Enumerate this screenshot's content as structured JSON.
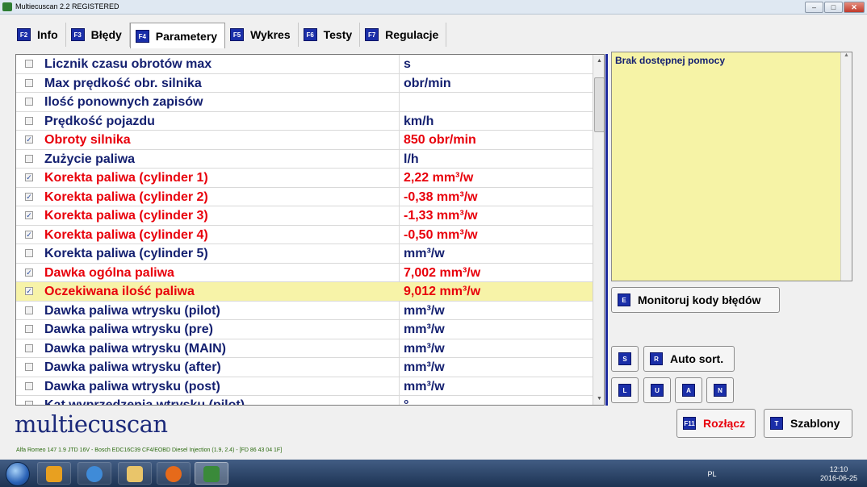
{
  "window": {
    "title": "Multiecuscan 2.2 REGISTERED"
  },
  "tabs": [
    {
      "key": "F2",
      "label": "Info"
    },
    {
      "key": "F3",
      "label": "Błędy"
    },
    {
      "key": "F4",
      "label": "Parametery",
      "active": true
    },
    {
      "key": "F5",
      "label": "Wykres"
    },
    {
      "key": "F6",
      "label": "Testy"
    },
    {
      "key": "F7",
      "label": "Regulacje"
    }
  ],
  "parameters": [
    {
      "name": "Licznik czasu obrotów max",
      "value": "s",
      "checked": false
    },
    {
      "name": "Max prędkość obr. silnika",
      "value": "obr/min",
      "checked": false
    },
    {
      "name": "Ilość ponownych zapisów",
      "value": "",
      "checked": false
    },
    {
      "name": "Prędkość pojazdu",
      "value": "km/h",
      "checked": false
    },
    {
      "name": "Obroty silnika",
      "value": "850 obr/min",
      "checked": true
    },
    {
      "name": "Zużycie paliwa",
      "value": "l/h",
      "checked": false
    },
    {
      "name": "Korekta paliwa (cylinder 1)",
      "value": "2,22 mm³/w",
      "checked": true
    },
    {
      "name": "Korekta paliwa (cylinder 2)",
      "value": "-0,38 mm³/w",
      "checked": true
    },
    {
      "name": "Korekta paliwa (cylinder 3)",
      "value": "-1,33 mm³/w",
      "checked": true
    },
    {
      "name": "Korekta paliwa (cylinder 4)",
      "value": "-0,50 mm³/w",
      "checked": true
    },
    {
      "name": "Korekta paliwa (cylinder 5)",
      "value": "mm³/w",
      "checked": false
    },
    {
      "name": "Dawka ogólna paliwa",
      "value": "7,002 mm³/w",
      "checked": true
    },
    {
      "name": "Oczekiwana ilość paliwa",
      "value": "9,012 mm³/w",
      "checked": true,
      "selected": true
    },
    {
      "name": "Dawka paliwa wtrysku (pilot)",
      "value": "mm³/w",
      "checked": false
    },
    {
      "name": "Dawka paliwa wtrysku (pre)",
      "value": "mm³/w",
      "checked": false
    },
    {
      "name": "Dawka paliwa wtrysku (MAIN)",
      "value": "mm³/w",
      "checked": false
    },
    {
      "name": "Dawka paliwa wtrysku (after)",
      "value": "mm³/w",
      "checked": false
    },
    {
      "name": "Dawka paliwa wtrysku (post)",
      "value": "mm³/w",
      "checked": false
    },
    {
      "name": "Kąt wyprzedzenia wtrysku (pilot)",
      "value": "°",
      "checked": false
    }
  ],
  "help": {
    "text": "Brak dostępnej pomocy"
  },
  "buttons": {
    "monitor": {
      "key": "E",
      "label": "Monitoruj kody błędów"
    },
    "s": {
      "key": "S"
    },
    "autosort": {
      "key": "R",
      "label": "Auto sort."
    },
    "l": {
      "key": "L"
    },
    "u": {
      "key": "U"
    },
    "a": {
      "key": "A"
    },
    "n": {
      "key": "N"
    },
    "disconnect": {
      "key": "F11",
      "label": "Rozłącz"
    },
    "templates": {
      "key": "T",
      "label": "Szablony"
    }
  },
  "logo": "multiecuscan",
  "status": "Alfa Romeo 147 1.9 JTD 16V - Bosch EDC16C39 CF4/EOBD Diesel Injection (1.9, 2.4) - [FD 86 43 04 1F]",
  "taskbar": {
    "lang": "PL",
    "time": "12:10",
    "date": "2016-06-25"
  },
  "colors": {
    "accent": "#1a2ea8",
    "active_value": "#e8000b",
    "text": "#142070",
    "help_bg": "#f6f3a6",
    "row_highlight": "#f7f3a8"
  }
}
